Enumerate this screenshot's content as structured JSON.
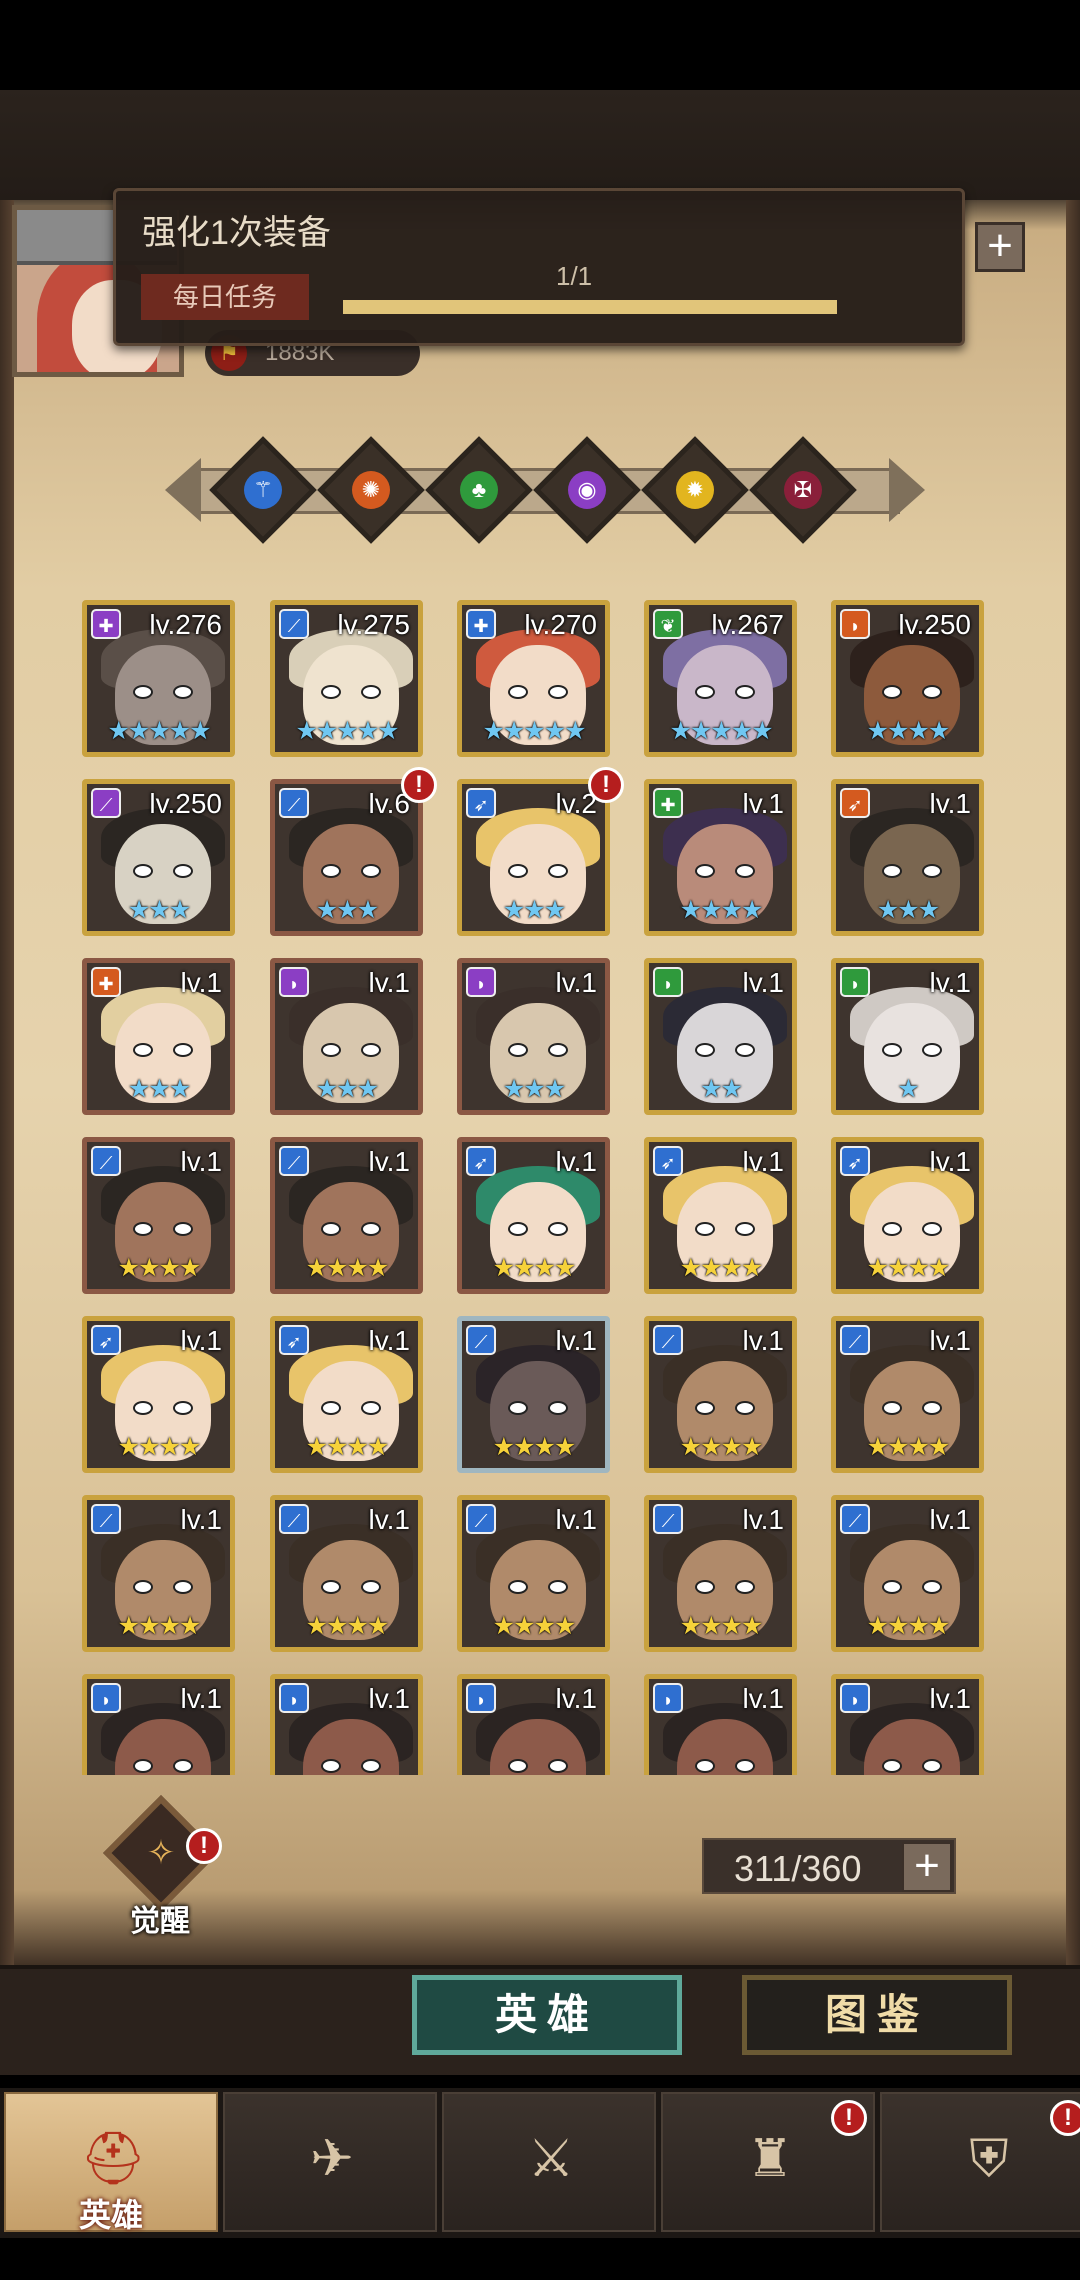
{
  "task": {
    "title": "强化1次装备",
    "tag": "每日任务",
    "count": "1/1",
    "progress": 1.0
  },
  "player": {
    "power": "1883K"
  },
  "top_add": "+",
  "factions": [
    {
      "name": "light-faction-icon",
      "glyph": "⚚",
      "color": "#2f6fd0"
    },
    {
      "name": "fire-faction-icon",
      "glyph": "✺",
      "color": "#d45a1f"
    },
    {
      "name": "nature-faction-icon",
      "glyph": "♣",
      "color": "#2f9a3c"
    },
    {
      "name": "arcane-faction-icon",
      "glyph": "◉",
      "color": "#8b3ec4"
    },
    {
      "name": "holy-faction-icon",
      "glyph": "✹",
      "color": "#e2b51f"
    },
    {
      "name": "dark-faction-icon",
      "glyph": "✠",
      "color": "#8a1f3a"
    }
  ],
  "heroes": [
    {
      "level": "lv.276",
      "stars": "★★★★★",
      "star_color": "blue",
      "frame": "gold",
      "cls_color": "#8b3ec4",
      "cls_glyph": "✚",
      "skin": "#9c8f88",
      "hair": "#5a4f48",
      "alert": false
    },
    {
      "level": "lv.275",
      "stars": "★★★★★",
      "star_color": "blue",
      "frame": "gold",
      "cls_color": "#2f6fd0",
      "cls_glyph": "⟋",
      "skin": "#efe3cf",
      "hair": "#d9cfb8",
      "alert": false
    },
    {
      "level": "lv.270",
      "stars": "★★★★★",
      "star_color": "blue",
      "frame": "gold",
      "cls_color": "#2f6fd0",
      "cls_glyph": "✚",
      "skin": "#f2dcc8",
      "hair": "#cf5a3e",
      "alert": false
    },
    {
      "level": "lv.267",
      "stars": "★★★★★",
      "star_color": "blue",
      "frame": "gold",
      "cls_color": "#2f9a3c",
      "cls_glyph": "❦",
      "skin": "#c9b7c9",
      "hair": "#7e6fa3",
      "alert": false
    },
    {
      "level": "lv.250",
      "stars": "★★★★",
      "star_color": "blue",
      "frame": "gold",
      "cls_color": "#d45a1f",
      "cls_glyph": "◗",
      "skin": "#8d5a3c",
      "hair": "#2d211c",
      "alert": false
    },
    {
      "level": "lv.250",
      "stars": "★★★",
      "star_color": "blue",
      "frame": "gold",
      "cls_color": "#8b3ec4",
      "cls_glyph": "⟋",
      "skin": "#d8d2c4",
      "hair": "#2b2622",
      "alert": false
    },
    {
      "level": "lv.6",
      "stars": "★★★",
      "star_color": "blue",
      "frame": "brown",
      "cls_color": "#2f6fd0",
      "cls_glyph": "⟋",
      "skin": "#a0745c",
      "hair": "#2b2622",
      "alert": true
    },
    {
      "level": "lv.2",
      "stars": "★★★",
      "star_color": "blue",
      "frame": "gold",
      "cls_color": "#2f6fd0",
      "cls_glyph": "➶",
      "skin": "#f2dcc8",
      "hair": "#e8c46a",
      "alert": true
    },
    {
      "level": "lv.1",
      "stars": "★★★★",
      "star_color": "blue",
      "frame": "gold",
      "cls_color": "#2f9a3c",
      "cls_glyph": "✚",
      "skin": "#b98b7a",
      "hair": "#3d2f4f",
      "alert": false
    },
    {
      "level": "lv.1",
      "stars": "★★★",
      "star_color": "blue",
      "frame": "gold",
      "cls_color": "#d45a1f",
      "cls_glyph": "➶",
      "skin": "#7a6650",
      "hair": "#2b2622",
      "alert": false
    },
    {
      "level": "lv.1",
      "stars": "★★★",
      "star_color": "blue",
      "frame": "brown",
      "cls_color": "#d45a1f",
      "cls_glyph": "✚",
      "skin": "#f2dcc8",
      "hair": "#e2cfa0",
      "alert": false
    },
    {
      "level": "lv.1",
      "stars": "★★★",
      "star_color": "blue",
      "frame": "brown",
      "cls_color": "#8b3ec4",
      "cls_glyph": "◗",
      "skin": "#d8c7ae",
      "hair": "#3a2f2a",
      "alert": false
    },
    {
      "level": "lv.1",
      "stars": "★★★",
      "star_color": "blue",
      "frame": "brown",
      "cls_color": "#8b3ec4",
      "cls_glyph": "◗",
      "skin": "#d8c7ae",
      "hair": "#3a2f2a",
      "alert": false
    },
    {
      "level": "lv.1",
      "stars": "★★",
      "star_color": "blue",
      "frame": "gold",
      "cls_color": "#2f9a3c",
      "cls_glyph": "◗",
      "skin": "#d9d6d8",
      "hair": "#2b2a35",
      "alert": false
    },
    {
      "level": "lv.1",
      "stars": "★",
      "star_color": "blue",
      "frame": "gold",
      "cls_color": "#2f9a3c",
      "cls_glyph": "◗",
      "skin": "#e8e2df",
      "hair": "#cfc9c4",
      "alert": false
    },
    {
      "level": "lv.1",
      "stars": "★★★★",
      "star_color": "gold",
      "frame": "brown",
      "cls_color": "#2f6fd0",
      "cls_glyph": "⟋",
      "skin": "#a0745c",
      "hair": "#2b2622",
      "alert": false
    },
    {
      "level": "lv.1",
      "stars": "★★★★",
      "star_color": "gold",
      "frame": "brown",
      "cls_color": "#2f6fd0",
      "cls_glyph": "⟋",
      "skin": "#a0745c",
      "hair": "#2b2622",
      "alert": false
    },
    {
      "level": "lv.1",
      "stars": "★★★★",
      "star_color": "gold",
      "frame": "brown",
      "cls_color": "#2f6fd0",
      "cls_glyph": "➶",
      "skin": "#f2dcc8",
      "hair": "#2e8a6a",
      "alert": false
    },
    {
      "level": "lv.1",
      "stars": "★★★★",
      "star_color": "gold",
      "frame": "gold",
      "cls_color": "#2f6fd0",
      "cls_glyph": "➶",
      "skin": "#f2dcc8",
      "hair": "#e8c46a",
      "alert": false
    },
    {
      "level": "lv.1",
      "stars": "★★★★",
      "star_color": "gold",
      "frame": "gold",
      "cls_color": "#2f6fd0",
      "cls_glyph": "➶",
      "skin": "#f2dcc8",
      "hair": "#e8c46a",
      "alert": false
    },
    {
      "level": "lv.1",
      "stars": "★★★★",
      "star_color": "gold",
      "frame": "gold",
      "cls_color": "#2f6fd0",
      "cls_glyph": "➶",
      "skin": "#f2dcc8",
      "hair": "#e8c46a",
      "alert": false
    },
    {
      "level": "lv.1",
      "stars": "★★★★",
      "star_color": "gold",
      "frame": "gold",
      "cls_color": "#2f6fd0",
      "cls_glyph": "➶",
      "skin": "#f2dcc8",
      "hair": "#e8c46a",
      "alert": false
    },
    {
      "level": "lv.1",
      "stars": "★★★★",
      "star_color": "gold",
      "frame": "silver",
      "cls_color": "#2f6fd0",
      "cls_glyph": "⟋",
      "skin": "#6a5a58",
      "hair": "#2b2428",
      "alert": false
    },
    {
      "level": "lv.1",
      "stars": "★★★★",
      "star_color": "gold",
      "frame": "gold",
      "cls_color": "#2f6fd0",
      "cls_glyph": "⟋",
      "skin": "#b08a6a",
      "hair": "#3a2f26",
      "alert": false
    },
    {
      "level": "lv.1",
      "stars": "★★★★",
      "star_color": "gold",
      "frame": "gold",
      "cls_color": "#2f6fd0",
      "cls_glyph": "⟋",
      "skin": "#b08a6a",
      "hair": "#3a2f26",
      "alert": false
    },
    {
      "level": "lv.1",
      "stars": "★★★★",
      "star_color": "gold",
      "frame": "gold",
      "cls_color": "#2f6fd0",
      "cls_glyph": "⟋",
      "skin": "#b08a6a",
      "hair": "#3a2f26",
      "alert": false
    },
    {
      "level": "lv.1",
      "stars": "★★★★",
      "star_color": "gold",
      "frame": "gold",
      "cls_color": "#2f6fd0",
      "cls_glyph": "⟋",
      "skin": "#b08a6a",
      "hair": "#3a2f26",
      "alert": false
    },
    {
      "level": "lv.1",
      "stars": "★★★★",
      "star_color": "gold",
      "frame": "gold",
      "cls_color": "#2f6fd0",
      "cls_glyph": "⟋",
      "skin": "#b08a6a",
      "hair": "#3a2f26",
      "alert": false
    },
    {
      "level": "lv.1",
      "stars": "★★★★",
      "star_color": "gold",
      "frame": "gold",
      "cls_color": "#2f6fd0",
      "cls_glyph": "⟋",
      "skin": "#b08a6a",
      "hair": "#3a2f26",
      "alert": false
    },
    {
      "level": "lv.1",
      "stars": "★★★★",
      "star_color": "gold",
      "frame": "gold",
      "cls_color": "#2f6fd0",
      "cls_glyph": "⟋",
      "skin": "#b08a6a",
      "hair": "#3a2f26",
      "alert": false
    },
    {
      "level": "lv.1",
      "stars": "",
      "star_color": "gold",
      "frame": "gold",
      "cls_color": "#2f6fd0",
      "cls_glyph": "◗",
      "skin": "#8d5a4a",
      "hair": "#2b2422",
      "alert": false
    },
    {
      "level": "lv.1",
      "stars": "",
      "star_color": "gold",
      "frame": "gold",
      "cls_color": "#2f6fd0",
      "cls_glyph": "◗",
      "skin": "#8d5a4a",
      "hair": "#2b2422",
      "alert": false
    },
    {
      "level": "lv.1",
      "stars": "",
      "star_color": "gold",
      "frame": "gold",
      "cls_color": "#2f6fd0",
      "cls_glyph": "◗",
      "skin": "#8d5a4a",
      "hair": "#2b2422",
      "alert": false
    },
    {
      "level": "lv.1",
      "stars": "",
      "star_color": "gold",
      "frame": "gold",
      "cls_color": "#2f6fd0",
      "cls_glyph": "◗",
      "skin": "#8d5a4a",
      "hair": "#2b2422",
      "alert": false
    },
    {
      "level": "lv.1",
      "stars": "",
      "star_color": "gold",
      "frame": "gold",
      "cls_color": "#2f6fd0",
      "cls_glyph": "◗",
      "skin": "#8d5a4a",
      "hair": "#2b2422",
      "alert": false
    }
  ],
  "awaken": {
    "label": "觉醒",
    "alert": "!"
  },
  "capacity": {
    "text": "311/360",
    "plus": "+"
  },
  "switch": {
    "heroes": "英雄",
    "codex": "图鉴"
  },
  "nav": [
    {
      "name": "nav-heroes",
      "icon_name": "helmet-icon",
      "glyph": "⛑",
      "label": "英雄",
      "active": true,
      "alert": false
    },
    {
      "name": "nav-adventure",
      "icon_name": "map-icon",
      "glyph": "✈",
      "label": "",
      "active": false,
      "alert": false
    },
    {
      "name": "nav-battle",
      "icon_name": "crossed-swords-icon",
      "glyph": "⚔",
      "label": "",
      "active": false,
      "alert": false
    },
    {
      "name": "nav-castle",
      "icon_name": "castle-icon",
      "glyph": "♜",
      "label": "",
      "active": false,
      "alert": true
    },
    {
      "name": "nav-guild",
      "icon_name": "handshake-icon",
      "glyph": "⛨",
      "label": "",
      "active": false,
      "alert": true
    }
  ],
  "alert_glyph": "!"
}
